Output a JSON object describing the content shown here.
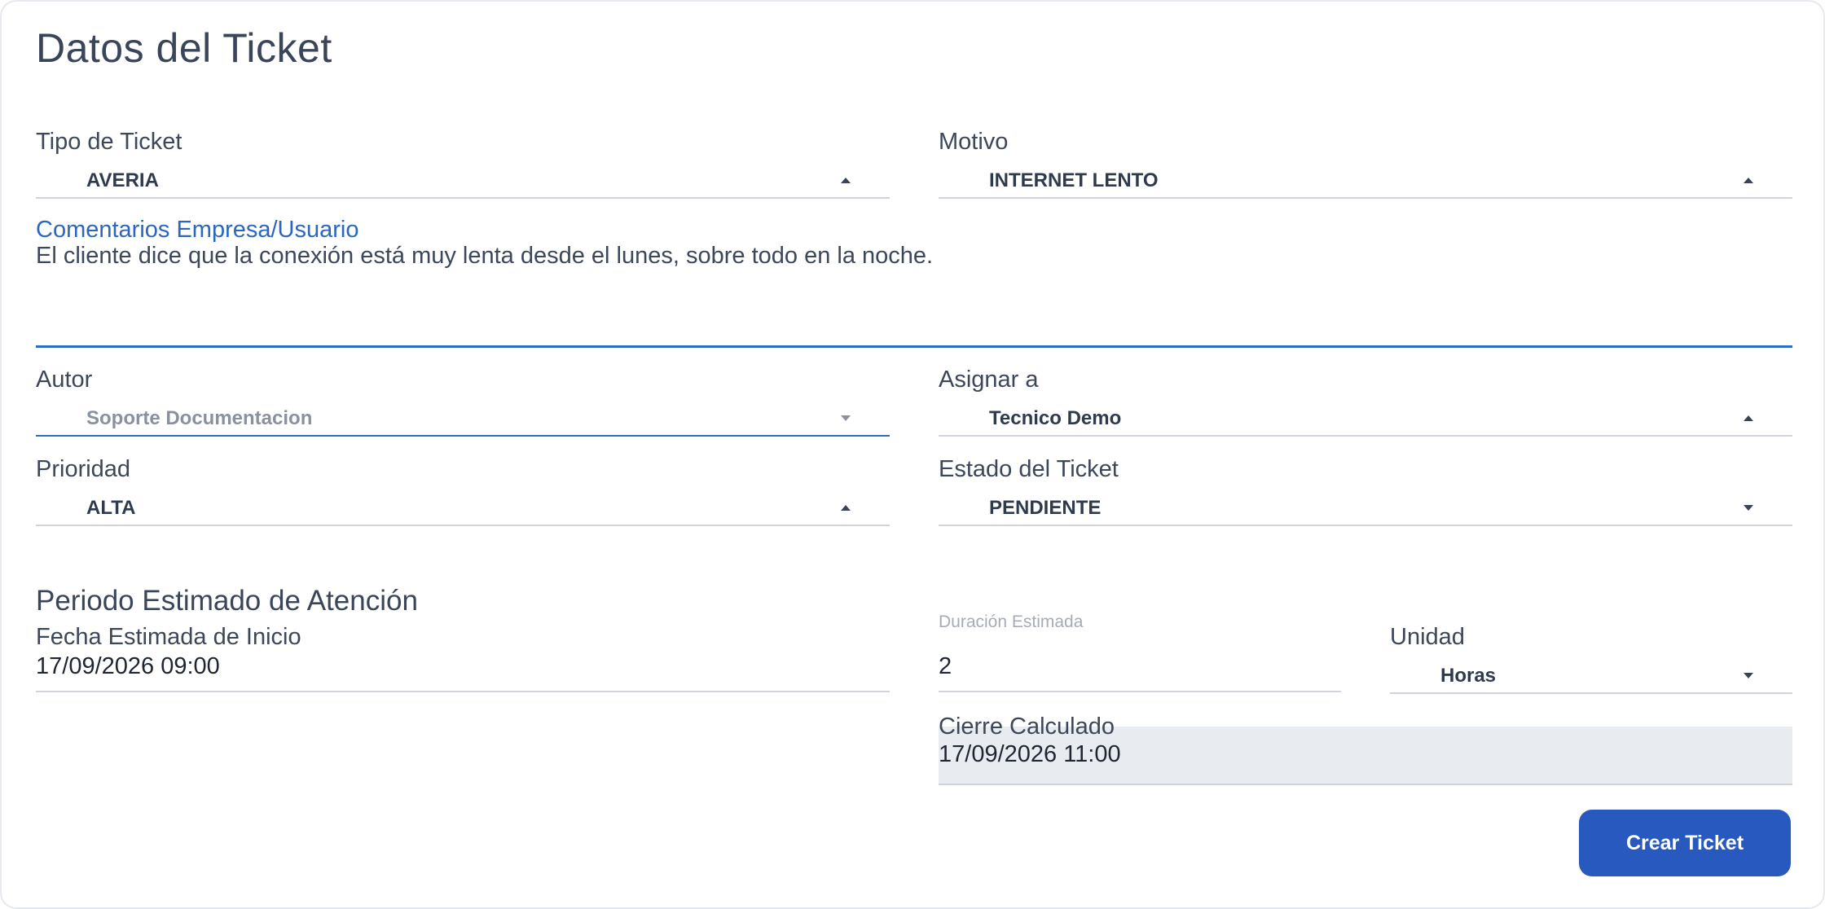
{
  "form": {
    "title": "Datos del Ticket",
    "tipo": {
      "label": "Tipo de Ticket",
      "value": "AVERIA"
    },
    "motivo": {
      "label": "Motivo",
      "value": "INTERNET LENTO"
    },
    "comentarios": {
      "label": "Comentarios Empresa/Usuario",
      "value": "El cliente dice que la conexión está muy lenta desde el lunes, sobre todo en la noche."
    },
    "autor": {
      "label": "Autor",
      "value": "Soporte Documentacion"
    },
    "asignar": {
      "label": "Asignar a",
      "value": "Tecnico Demo"
    },
    "prioridad": {
      "label": "Prioridad",
      "value": "ALTA"
    },
    "estado": {
      "label": "Estado del Ticket",
      "value": "PENDIENTE"
    }
  },
  "periodo": {
    "section_title": "Periodo Estimado de Atención",
    "fecha_inicio": {
      "label": "Fecha Estimada de Inicio",
      "value": "17/09/2026 09:00"
    },
    "duracion": {
      "label": "Duración Estimada",
      "value": "2"
    },
    "unidad": {
      "label": "Unidad",
      "value": "Horas"
    },
    "cierre": {
      "label": "Cierre Calculado",
      "value": "17/09/2026 11:00"
    }
  },
  "actions": {
    "submit_label": "Crear Ticket"
  },
  "colors": {
    "accent": "#2759bf",
    "focus_line": "#2b6cc4",
    "link_label": "#2b66bf"
  }
}
